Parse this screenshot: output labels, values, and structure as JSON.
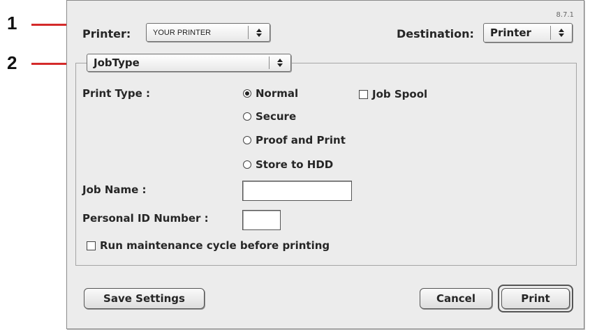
{
  "callouts": [
    "1",
    "2"
  ],
  "dialog": {
    "version": "8.7.1",
    "printer_label": "Printer:",
    "printer_value": "YOUR PRINTER",
    "destination_label": "Destination:",
    "destination_value": "Printer",
    "panel_value": "JobType",
    "print_type_label": "Print Type :",
    "print_type_options": [
      {
        "label": "Normal",
        "selected": true
      },
      {
        "label": "Secure",
        "selected": false
      },
      {
        "label": "Proof and Print",
        "selected": false
      },
      {
        "label": "Store to HDD",
        "selected": false
      }
    ],
    "job_spool_label": "Job Spool",
    "job_name_label": "Job Name :",
    "job_name_value": "",
    "personal_id_label": "Personal ID Number :",
    "personal_id_value": "",
    "maintenance_label": "Run maintenance cycle before printing",
    "save_settings_label": "Save Settings",
    "cancel_label": "Cancel",
    "print_label": "Print"
  },
  "colors": {
    "callout": "#d42a2a",
    "dialog_bg": "#ececec"
  }
}
